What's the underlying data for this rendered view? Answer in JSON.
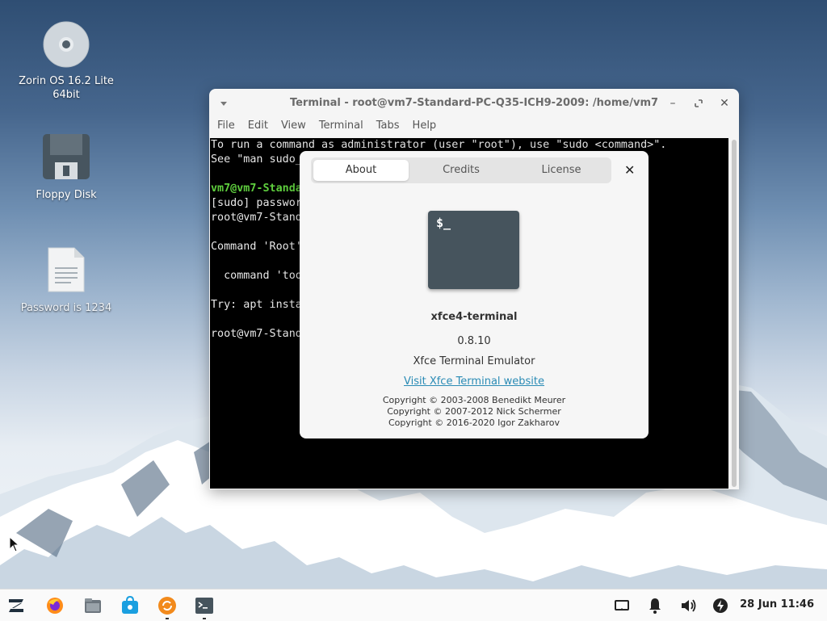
{
  "desktop": {
    "icons": [
      {
        "label_line1": "Zorin OS 16.2 Lite",
        "label_line2": "64bit",
        "icon": "optical-disc-icon"
      },
      {
        "label": "Floppy Disk",
        "icon": "floppy-disk-icon"
      },
      {
        "label": "Password is 1234",
        "icon": "text-file-icon"
      }
    ]
  },
  "terminal": {
    "title": "Terminal - root@vm7-Standard-PC-Q35-ICH9-2009: /home/vm7",
    "menu": [
      "File",
      "Edit",
      "View",
      "Terminal",
      "Tabs",
      "Help"
    ],
    "lines": [
      {
        "text": "To run a command as administrator (user \"root\"), use \"sudo <command>\".",
        "style": "normal"
      },
      {
        "text": "See \"man sudo_",
        "style": "normal"
      },
      {
        "text": "",
        "style": "normal"
      },
      {
        "text": "vm7@vm7-Standa",
        "style": "green"
      },
      {
        "text": "[sudo] passwor",
        "style": "normal"
      },
      {
        "text": "root@vm7-Stand",
        "style": "normal"
      },
      {
        "text": "",
        "style": "normal"
      },
      {
        "text": "Command 'Root'",
        "style": "normal"
      },
      {
        "text": "",
        "style": "normal"
      },
      {
        "text": "  command 'too",
        "style": "normal"
      },
      {
        "text": "",
        "style": "normal"
      },
      {
        "text": "Try: apt insta",
        "style": "normal"
      },
      {
        "text": "",
        "style": "normal"
      },
      {
        "text": "root@vm7-Stand",
        "style": "normal"
      }
    ]
  },
  "about_dialog": {
    "tabs": [
      "About",
      "Credits",
      "License"
    ],
    "active_tab": "About",
    "icon_prompt": "$_",
    "app_name": "xfce4-terminal",
    "version": "0.8.10",
    "description": "Xfce Terminal Emulator",
    "website_link": "Visit Xfce Terminal website",
    "copyright": [
      "Copyright © 2003-2008 Benedikt Meurer",
      "Copyright © 2007-2012 Nick Schermer",
      "Copyright © 2016-2020 Igor Zakharov"
    ],
    "link_color": "#2a8bb5"
  },
  "taskbar": {
    "clock": "28 Jun 11:46",
    "launchers": [
      "zorin-menu-icon",
      "firefox-icon",
      "files-icon",
      "software-store-icon",
      "software-updater-icon",
      "terminal-icon"
    ],
    "tray": [
      "display-icon",
      "notification-bell-icon",
      "volume-icon",
      "power-icon"
    ]
  }
}
